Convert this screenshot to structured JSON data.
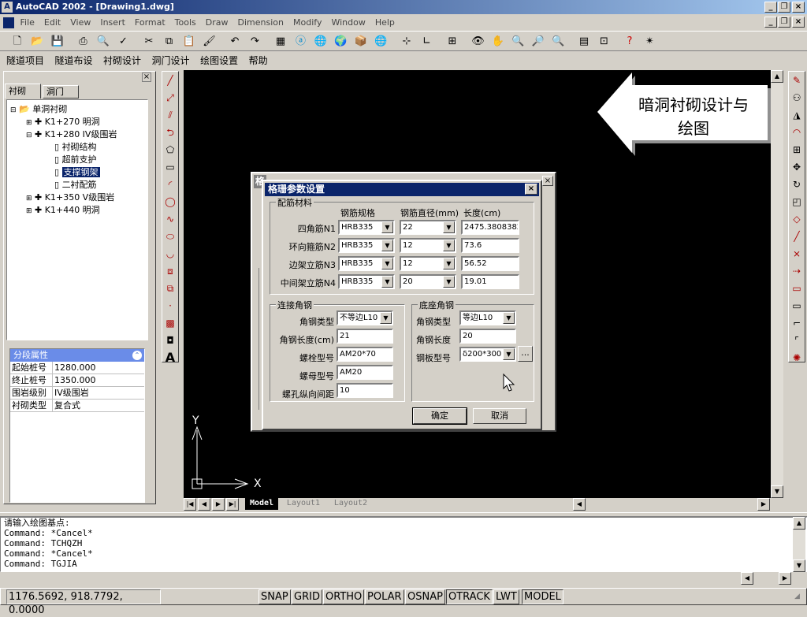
{
  "app": {
    "title": "AutoCAD 2002 - [Drawing1.dwg]"
  },
  "menu": [
    "File",
    "Edit",
    "View",
    "Insert",
    "Format",
    "Tools",
    "Draw",
    "Dimension",
    "Modify",
    "Window",
    "Help"
  ],
  "cn_menu": [
    "隧道项目",
    "隧道布设",
    "衬砌设计",
    "洞门设计",
    "绘图设置",
    "帮助"
  ],
  "panel": {
    "tabs": [
      "衬砌",
      "洞门"
    ],
    "tree": [
      {
        "label": "单洞衬砌",
        "level": 0,
        "folder": true
      },
      {
        "label": "K1+270  明洞",
        "level": 1
      },
      {
        "label": "K1+280  IV级围岩",
        "level": 1
      },
      {
        "label": "衬砌结构",
        "level": 2
      },
      {
        "label": "超前支护",
        "level": 2
      },
      {
        "label": "支撑钢架",
        "level": 2,
        "selected": true
      },
      {
        "label": "二衬配筋",
        "level": 2
      },
      {
        "label": "K1+350  V级围岩",
        "level": 1
      },
      {
        "label": "K1+440  明洞",
        "level": 1
      }
    ],
    "props_title": "分段属性",
    "props": [
      {
        "k": "起始桩号",
        "v": "1280.000"
      },
      {
        "k": "终止桩号",
        "v": "1350.000"
      },
      {
        "k": "围岩级别",
        "v": "IV级围岩"
      },
      {
        "k": "衬砌类型",
        "v": "复合式"
      }
    ]
  },
  "callout": {
    "line1": "暗洞衬砌设计与",
    "line2": "绘图"
  },
  "ucs": {
    "x": "X",
    "y": "Y"
  },
  "layout_tabs": [
    "Model",
    "Layout1",
    "Layout2"
  ],
  "dialog": {
    "title": "格珊参数设置",
    "back_title_char": "格",
    "group1": {
      "title": "配筋材料",
      "headers": [
        "钢筋规格",
        "钢筋直径(mm)",
        "长度(cm)"
      ],
      "rows": [
        {
          "label": "四角筋N1",
          "spec": "HRB335",
          "dia": "22",
          "len": "2475.3808382"
        },
        {
          "label": "环向箍筋N2",
          "spec": "HRB335",
          "dia": "12",
          "len": "73.6"
        },
        {
          "label": "边架立筋N3",
          "spec": "HRB335",
          "dia": "12",
          "len": "56.52"
        },
        {
          "label": "中间架立筋N4",
          "spec": "HRB335",
          "dia": "20",
          "len": "19.01"
        }
      ]
    },
    "group2": {
      "title": "连接角钢",
      "type_label": "角钢类型",
      "type_value": "不等边L10",
      "len_label": "角钢长度(cm)",
      "len_value": "21",
      "bolt_label": "螺栓型号",
      "bolt_value": "AM20*70",
      "nut_label": "螺母型号",
      "nut_value": "AM20",
      "gap_label": "螺孔纵向间距",
      "gap_value": "10"
    },
    "group3": {
      "title": "底座角钢",
      "type_label": "角钢类型",
      "type_value": "等边L10",
      "len_label": "角钢长度",
      "len_value": "20",
      "plate_label": "钢板型号",
      "plate_value": "δ200*300",
      "browse": "..."
    },
    "ok": "确定",
    "cancel": "取消"
  },
  "command": {
    "lines": [
      "请输入绘图基点:",
      "Command: *Cancel*",
      "Command: TCHQZH",
      "Command: *Cancel*",
      "Command: TGJIA"
    ]
  },
  "status": {
    "coords": "1176.5692, 918.7792, 0.0000",
    "buttons": [
      "SNAP",
      "GRID",
      "ORTHO",
      "POLAR",
      "OSNAP",
      "OTRACK",
      "LWT",
      "MODEL"
    ]
  },
  "colors": {
    "accent": "#0a246a",
    "canvas": "#000000",
    "face": "#d4d0c8"
  }
}
